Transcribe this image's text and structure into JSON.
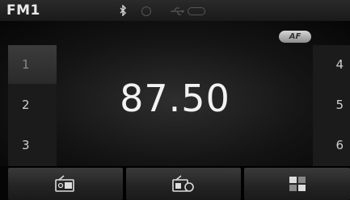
{
  "status": {
    "band": "FM1",
    "icons": [
      "bluetooth-icon",
      "disc-icon",
      "usb-icon",
      "ipod-icon"
    ]
  },
  "badge": {
    "af": "AF"
  },
  "presets": {
    "left": [
      "1",
      "2",
      "3"
    ],
    "right": [
      "4",
      "5",
      "6"
    ],
    "selected": "1"
  },
  "tuner": {
    "frequency": "87.50"
  },
  "bottom_buttons": [
    "radio-band-icon",
    "radio-menu-icon",
    "grid-menu-icon"
  ]
}
